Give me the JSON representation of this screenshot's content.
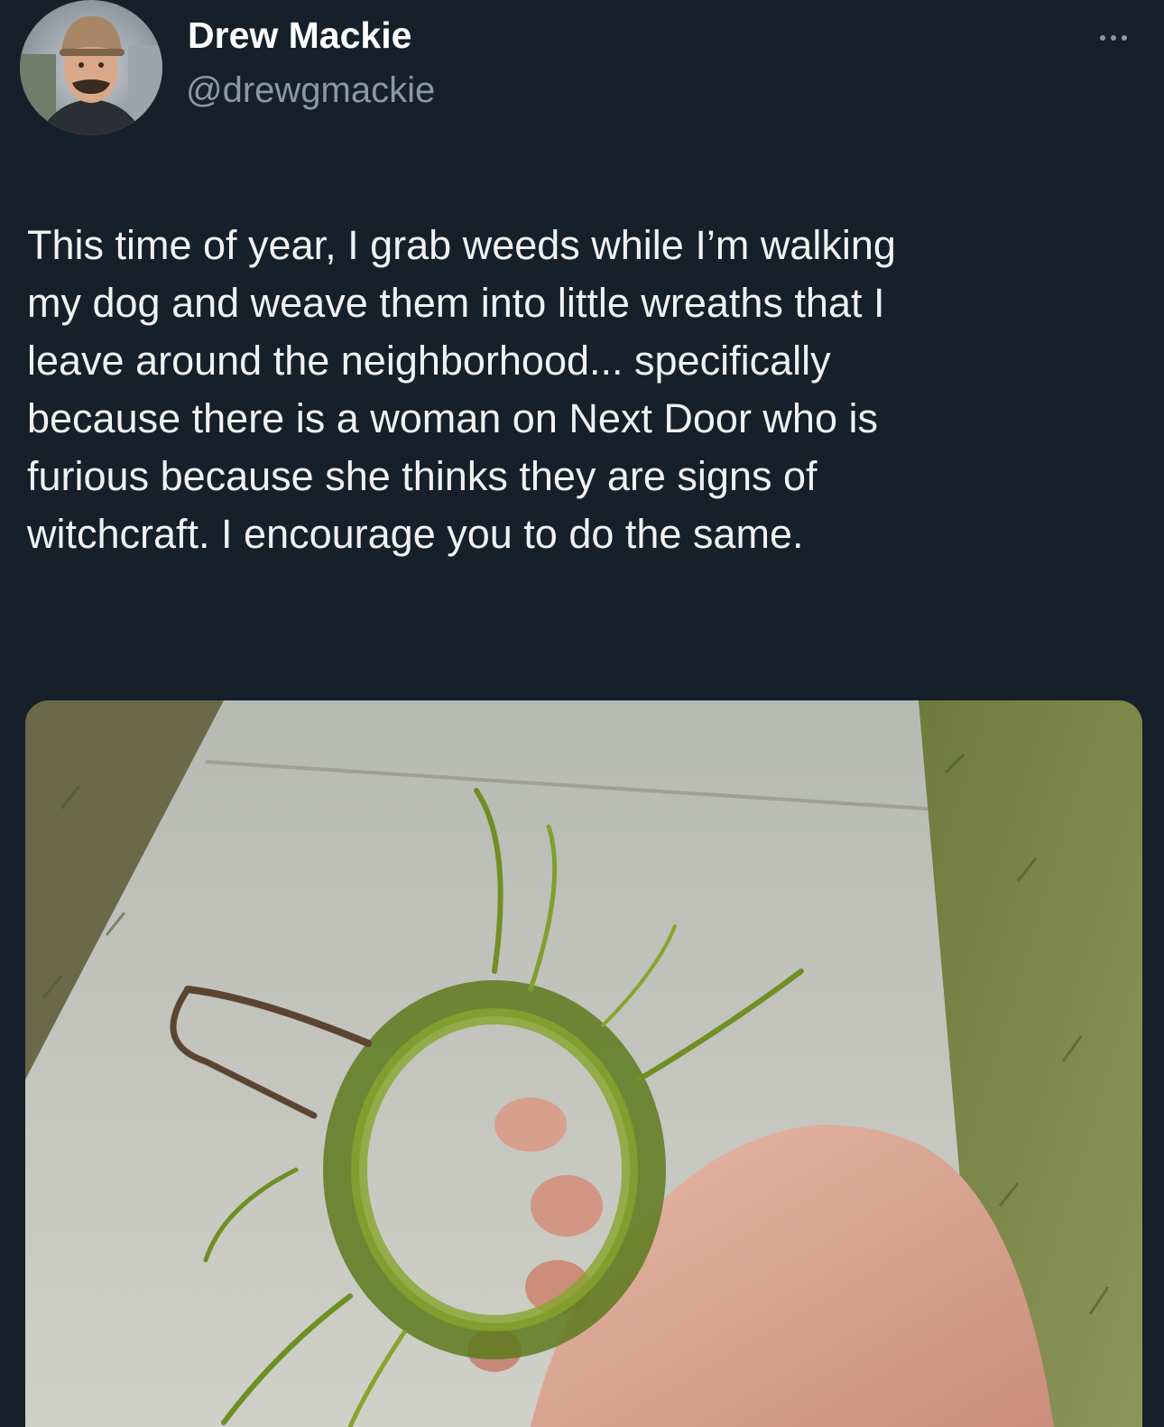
{
  "tweet": {
    "author": {
      "display_name": "Drew Mackie",
      "handle": "@drewgmackie",
      "avatar_icon": "profile-photo"
    },
    "more_icon": "more-options-icon",
    "text_lines": [
      "This time of year, I grab weeds while I’m walking",
      "my dog and weave them into little wreaths that I",
      "leave around the neighborhood... specifically",
      "because there is a woman on Next Door who is",
      "furious because she thinks they are signs of",
      "witchcraft. I encourage you to do the same."
    ],
    "media": {
      "kind": "photo"
    }
  },
  "colors": {
    "background": "#15202b",
    "text": "#f1f1f1",
    "secondary_text": "#8b98a5"
  }
}
